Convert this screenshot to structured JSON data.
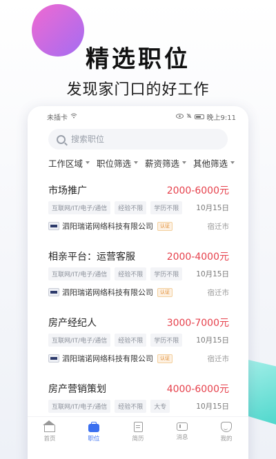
{
  "promo": {
    "headline": "精选职位",
    "subline": "发现家门口的好工作"
  },
  "statusbar": {
    "carrier": "未插卡",
    "time": "晚上9:11"
  },
  "search": {
    "placeholder": "搜索职位"
  },
  "filters": [
    {
      "label": "工作区域"
    },
    {
      "label": "职位筛选"
    },
    {
      "label": "薪资筛选"
    },
    {
      "label": "其他筛选"
    }
  ],
  "jobs": [
    {
      "title": "市场推广",
      "salary": "2000-6000元",
      "tags": [
        "互联网/IT/电子/通信",
        "经验不限",
        "学历不限"
      ],
      "date": "10月15日",
      "company": "泗阳瑞诺网络科技有限公司",
      "verified": "认证",
      "city": "宿迁市"
    },
    {
      "title": "相亲平台：运营客服",
      "salary": "2000-4000元",
      "tags": [
        "互联网/IT/电子/通信",
        "经验不限",
        "学历不限"
      ],
      "date": "10月15日",
      "company": "泗阳瑞诺网络科技有限公司",
      "verified": "认证",
      "city": "宿迁市"
    },
    {
      "title": "房产经纪人",
      "salary": "3000-7000元",
      "tags": [
        "互联网/IT/电子/通信",
        "经验不限",
        "学历不限"
      ],
      "date": "10月15日",
      "company": "泗阳瑞诺网络科技有限公司",
      "verified": "认证",
      "city": "宿迁市"
    },
    {
      "title": "房产营销策划",
      "salary": "4000-6000元",
      "tags": [
        "互联网/IT/电子/通信",
        "经验不限",
        "大专"
      ],
      "date": "10月15日"
    }
  ],
  "tabbar": [
    {
      "label": "首页",
      "icon": "home-icon",
      "active": false
    },
    {
      "label": "职位",
      "icon": "briefcase-icon",
      "active": true
    },
    {
      "label": "简历",
      "icon": "resume-icon",
      "active": false
    },
    {
      "label": "消息",
      "icon": "message-icon",
      "active": false
    },
    {
      "label": "我的",
      "icon": "profile-icon",
      "active": false
    }
  ],
  "colors": {
    "accent": "#3a6ff0",
    "salary": "#e6414c",
    "deco_pink": "#f06ad1",
    "deco_purple": "#a46cf2",
    "deco_teal": "#34d3c5"
  }
}
